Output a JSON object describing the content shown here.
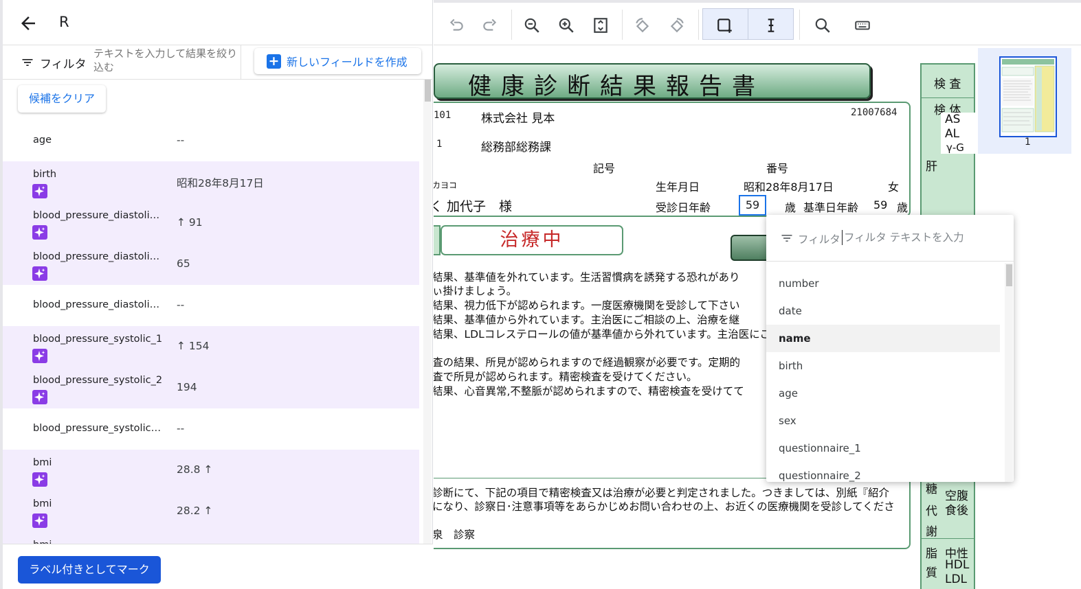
{
  "header": {
    "title": "R"
  },
  "filter": {
    "label": "フィルタ",
    "placeholder": "テキストを入力して結果を絞り込む"
  },
  "create_field_label": "新しいフィールドを作成",
  "clear_label": "候補をクリア",
  "fields": [
    {
      "name": "age",
      "value": "--",
      "ai": false
    },
    {
      "name": "birth",
      "value": "昭和28年8月17日",
      "ai": true
    },
    {
      "name": "blood_pressure_diastolic_1",
      "value": "↑ 91",
      "ai": true
    },
    {
      "name": "blood_pressure_diastolic_2",
      "value": "65",
      "ai": true
    },
    {
      "name": "blood_pressure_diastolic_...",
      "value": "--",
      "ai": false
    },
    {
      "name": "blood_pressure_systolic_1",
      "value": "↑ 154",
      "ai": true
    },
    {
      "name": "blood_pressure_systolic_2",
      "value": "194",
      "ai": true
    },
    {
      "name": "blood_pressure_systolic_...",
      "value": "--",
      "ai": false
    },
    {
      "name": "bmi",
      "value": "28.8 ↑",
      "ai": true
    },
    {
      "name": "bmi",
      "value": "28.2 ↑",
      "ai": true
    },
    {
      "name": "bmi",
      "value": "",
      "ai": true
    }
  ],
  "mark_label": "ラベル付きとしてマーク",
  "toolbar": {
    "icons": [
      "undo-icon",
      "redo-icon",
      "zoom-out-icon",
      "zoom-in-icon",
      "fit-page-icon",
      "rotate-left-icon",
      "rotate-right-icon",
      "bounding-box-icon",
      "text-select-icon",
      "search-icon",
      "keyboard-icon"
    ]
  },
  "document": {
    "title": "健康診断結果報告書",
    "code_left": "101",
    "company": "株式会社 見本",
    "id_number": "21007684",
    "code_left2": "1",
    "department": "総務部総務課",
    "kigo": "記号",
    "bango": "番号",
    "kana": "カヨコ",
    "birth_label": "生年月日",
    "birth_value": "昭和28年8月17日",
    "sex": "女",
    "name": "く 加代子　様",
    "exam_age_label": "受診日年齢",
    "exam_age_value": "59",
    "age_unit": "歳",
    "base_age_label": "基準日年齢",
    "base_age_value": "59",
    "age_unit2": "歳",
    "treatment": "治療中",
    "paragraph1": [
      "結果、基準値を外れています。生活習慣病を誘発する恐れがあり",
      "ぃ掛けましょう。",
      "結果、視力低下が認められます。一度医療機関を受診して下さい",
      "結果、基準値から外れています。主治医にご相談の上、治療を継",
      "結果、LDLコレステロールの値が基準値から外れています。主治医にこ"
    ],
    "paragraph2": [
      "査の結果、所見が認められますので経過観察が必要です。定期的",
      "査で所見が認められます。精密検査を受けてください。",
      "結果、心音異常,不整脈が認められますので、精密検査を受けてて"
    ],
    "paragraph3": [
      "診断にて、下記の項目で精密検査又は治療が必要と判定されました。つきましては、別紙『紹介",
      "になり、診察日･注意事項等をあらかじめお問い合わせの上、お近くの医療機関を受診してくださ"
    ],
    "consult": "泉　診察",
    "table": {
      "header1": "検 査",
      "header2": "検 体",
      "ast": "AS",
      "alt": "AL",
      "ggt": "γ-G",
      "liver": "肝",
      "sugar": "糖",
      "fasting": "空腹",
      "after_meal": "食後",
      "metab1": "代",
      "metab2": "謝",
      "lipid1": "脂",
      "lipid2": "質",
      "neutral": "中性",
      "hdl": "HDL",
      "ldl": "LDL"
    }
  },
  "thumbnail": {
    "page_label": "1"
  },
  "dropdown": {
    "filter_label": "フィルタ",
    "placeholder": "フィルタ テキストを入力",
    "items": [
      "number",
      "date",
      "name",
      "birth",
      "age",
      "sex",
      "questionnaire_1",
      "questionnaire_2"
    ],
    "highlighted": "name"
  },
  "colors": {
    "accent": "#1a73e8",
    "primary_button": "#1a56d8",
    "ai_row": "#f3edfd",
    "sparkle": "#8a3ce6",
    "doc_green": "#5a9a72",
    "treatment_red": "#c62828"
  }
}
